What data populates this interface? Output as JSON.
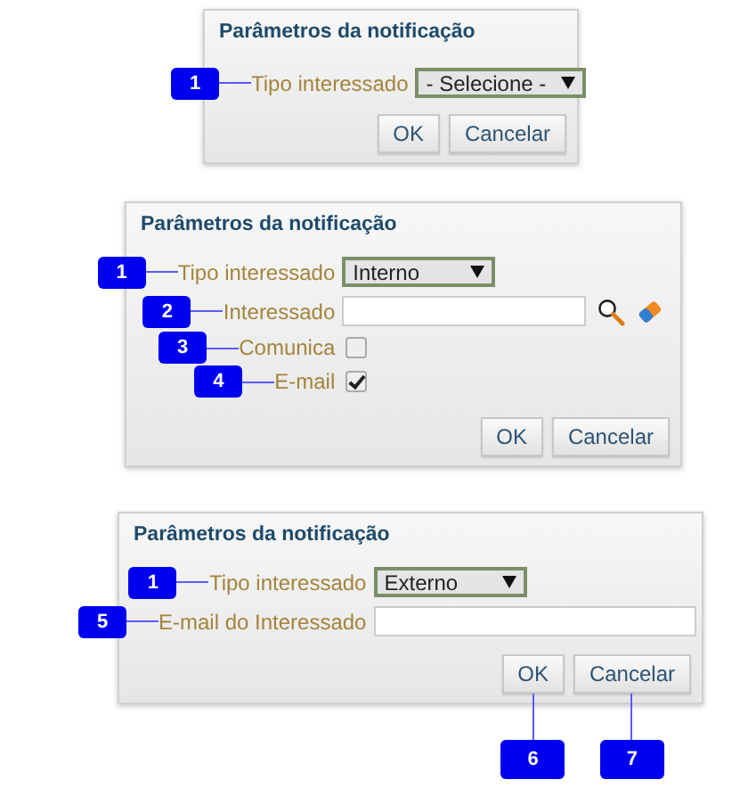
{
  "dialogs": [
    {
      "title": "Parâmetros da notificação",
      "fields": [
        {
          "kind": "select",
          "label": "Tipo interessado",
          "value": "- Selecione -",
          "callout": "1"
        }
      ],
      "buttons": [
        {
          "label": "OK"
        },
        {
          "label": "Cancelar"
        }
      ]
    },
    {
      "title": "Parâmetros da notificação",
      "fields": [
        {
          "kind": "select",
          "label": "Tipo interessado",
          "value": "Interno",
          "callout": "1"
        },
        {
          "kind": "lookup",
          "label": "Interessado",
          "callout": "2"
        },
        {
          "kind": "checkbox",
          "label": "Comunica",
          "checked": false,
          "callout": "3"
        },
        {
          "kind": "checkbox",
          "label": "E-mail",
          "checked": true,
          "callout": "4"
        }
      ],
      "buttons": [
        {
          "label": "OK"
        },
        {
          "label": "Cancelar"
        }
      ]
    },
    {
      "title": "Parâmetros da notificação",
      "fields": [
        {
          "kind": "select",
          "label": "Tipo interessado",
          "value": "Externo",
          "callout": "1"
        },
        {
          "kind": "text",
          "label": "E-mail do Interessado",
          "callout": "5"
        }
      ],
      "buttons": [
        {
          "label": "OK",
          "callout": "6"
        },
        {
          "label": "Cancelar",
          "callout": "7"
        }
      ]
    }
  ]
}
